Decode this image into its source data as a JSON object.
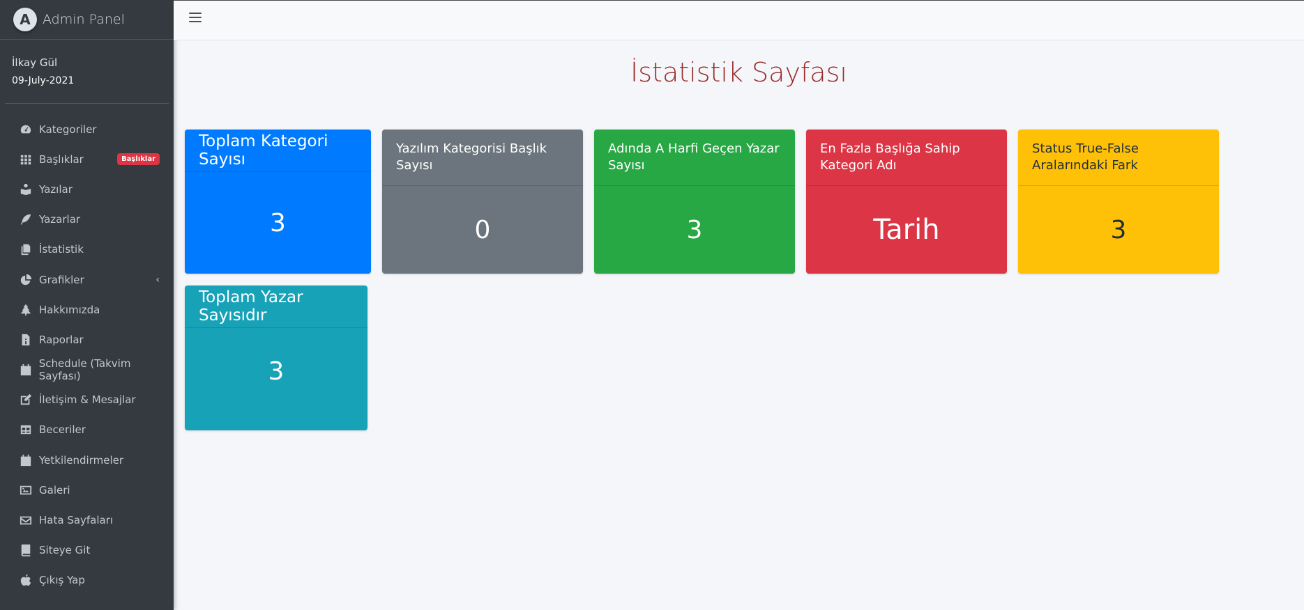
{
  "brand": {
    "logo_letter": "A",
    "title": "Admin Panel"
  },
  "user": {
    "name": "İlkay Gül",
    "date": "09-July-2021"
  },
  "nav": [
    {
      "label": "Kategoriler",
      "icon": "dashboard-icon"
    },
    {
      "label": "Başlıklar",
      "icon": "grid-icon",
      "badge": "Başlıklar"
    },
    {
      "label": "Yazılar",
      "icon": "reader-icon"
    },
    {
      "label": "Yazarlar",
      "icon": "feather-icon"
    },
    {
      "label": "İstatistik",
      "icon": "copy-icon"
    },
    {
      "label": "Grafikler",
      "icon": "pie-chart-icon",
      "chevron": "‹"
    },
    {
      "label": "Hakkımızda",
      "icon": "tree-icon"
    },
    {
      "label": "Raporlar",
      "icon": "file-icon"
    },
    {
      "label": "Schedule (Takvim Sayfası)",
      "icon": "calendar-icon"
    },
    {
      "label": "İletişim & Mesajlar",
      "icon": "edit-icon"
    },
    {
      "label": "Beceriler",
      "icon": "table-icon"
    },
    {
      "label": "Yetkilendirmeler",
      "icon": "calendar-icon"
    },
    {
      "label": "Galeri",
      "icon": "image-icon"
    },
    {
      "label": "Hata Sayfaları",
      "icon": "envelope-icon"
    },
    {
      "label": "Siteye Git",
      "icon": "book-icon"
    },
    {
      "label": "Çıkış Yap",
      "icon": "apple-icon"
    }
  ],
  "page": {
    "title": "İstatistik Sayfası"
  },
  "cards": [
    {
      "title": "Toplam Kategori Sayısı",
      "value": "3",
      "color": "#007bff"
    },
    {
      "title": "Yazılım Kategorisi Başlık Sayısı",
      "value": "0",
      "color": "#6c757d"
    },
    {
      "title": "Adında A Harfi Geçen Yazar Sayısı",
      "value": "3",
      "color": "#28a745"
    },
    {
      "title": "En Fazla Başlığa Sahip Kategori Adı",
      "value": "Tarih",
      "color": "#dc3545"
    },
    {
      "title": "Status True-False Aralarındaki Fark",
      "value": "3",
      "color": "#ffc107"
    },
    {
      "title": "Toplam Yazar Sayısıdır",
      "value": "3",
      "color": "#17a2b8"
    }
  ]
}
